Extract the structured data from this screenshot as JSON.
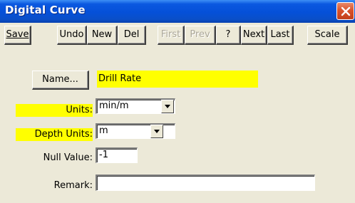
{
  "window": {
    "title": "Digital Curve"
  },
  "toolbar": {
    "save_label": "Save",
    "undo_label": "Undo",
    "new_label": "New",
    "del_label": "Del",
    "first_label": "First",
    "prev_label": "Prev",
    "help_label": "?",
    "next_label": "Next",
    "last_label": "Last",
    "scale_label": "Scale"
  },
  "form": {
    "name_button_label": "Name...",
    "name_value": "Drill Rate",
    "units_label": "Units:",
    "units_value": "min/m",
    "depth_units_label": "Depth Units:",
    "depth_units_value": "m",
    "null_value_label": "Null Value:",
    "null_value": "-1",
    "remark_label": "Remark:",
    "remark_value": ""
  },
  "colors": {
    "highlight": "#ffff00",
    "titlebar": "#0a58e0",
    "window_bg": "#ece9d8"
  },
  "icons": {
    "close": "close-icon",
    "dropdown": "chevron-down-icon"
  }
}
